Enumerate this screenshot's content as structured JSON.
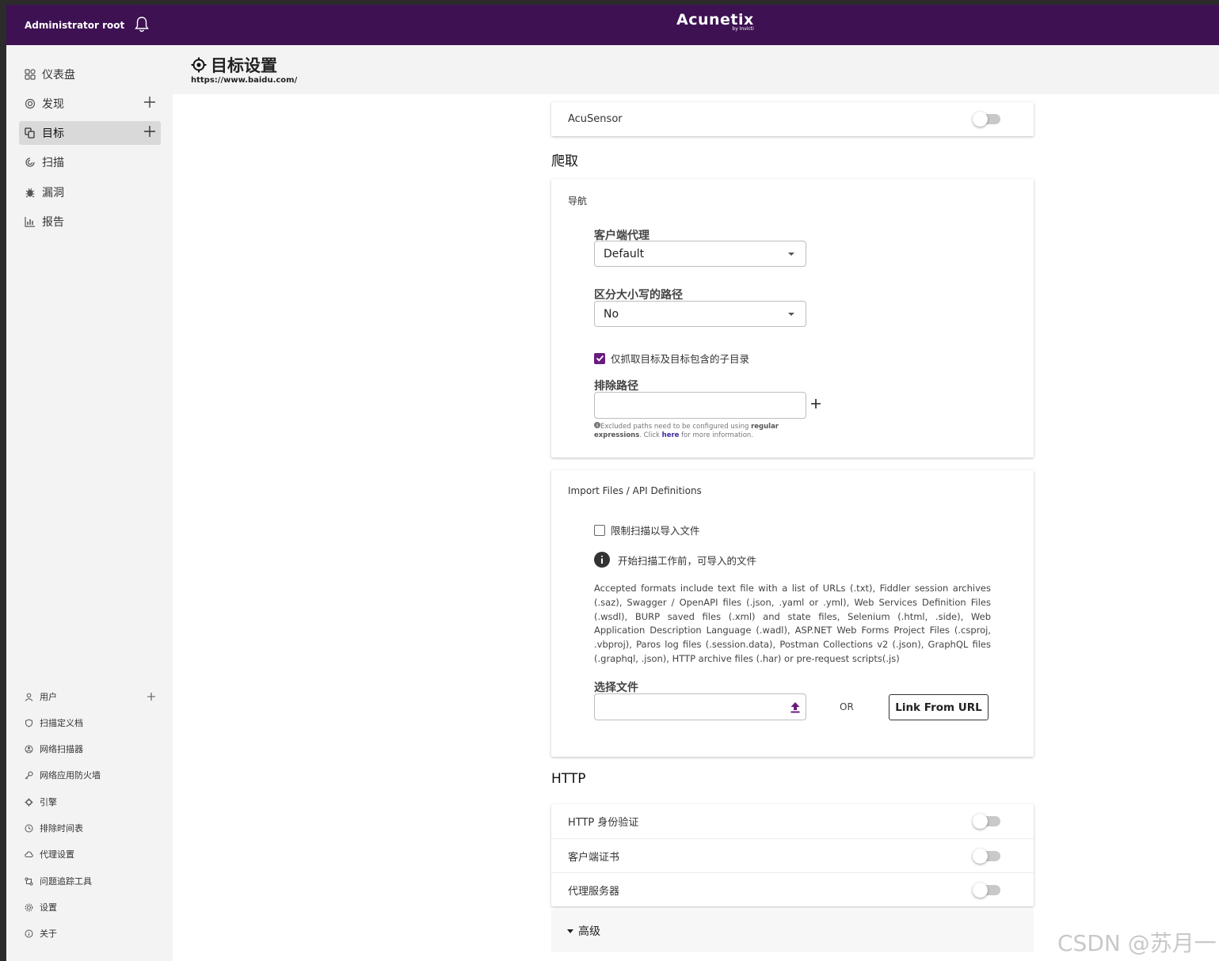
{
  "topbar": {
    "user": "Administrator root",
    "logo_name": "Acunetix",
    "logo_by": "by Invicti",
    "bell_icon": "bell-icon"
  },
  "sidebar": {
    "main_items": [
      {
        "label": "仪表盘",
        "icon": "dashboard-icon"
      },
      {
        "label": "发现",
        "icon": "discovery-icon",
        "has_add": true
      },
      {
        "label": "目标",
        "icon": "targets-icon",
        "has_add": true,
        "active": true
      },
      {
        "label": "扫描",
        "icon": "scans-icon"
      },
      {
        "label": "漏洞",
        "icon": "bug-icon"
      },
      {
        "label": "报告",
        "icon": "chart-icon"
      }
    ],
    "bottom_items": [
      {
        "label": "用户",
        "icon": "user-icon",
        "has_add": true
      },
      {
        "label": "扫描定义档",
        "icon": "shield-icon"
      },
      {
        "label": "网络扫描器",
        "icon": "network-icon"
      },
      {
        "label": "网络应用防火墙",
        "icon": "key-icon"
      },
      {
        "label": "引擎",
        "icon": "engine-icon"
      },
      {
        "label": "排除时间表",
        "icon": "clock-icon"
      },
      {
        "label": "代理设置",
        "icon": "cloud-icon"
      },
      {
        "label": "问题追踪工具",
        "icon": "tracker-icon"
      },
      {
        "label": "设置",
        "icon": "gear-icon"
      },
      {
        "label": "关于",
        "icon": "info-icon"
      }
    ]
  },
  "header": {
    "title": "目标设置",
    "url": "https://www.baidu.com/"
  },
  "acusensor": {
    "label": "AcuSensor",
    "enabled": false
  },
  "crawl": {
    "section_title": "爬取",
    "navigation": {
      "card_label": "导航",
      "user_agent_label": "客户端代理",
      "user_agent_value": "Default",
      "case_sensitive_label": "区分大小写的路径",
      "case_sensitive_value": "No",
      "limit_checkbox_label": "仅抓取目标及目标包含的子目录",
      "limit_checked": true,
      "exclude_label": "排除路径",
      "exclude_value": "",
      "hint_part1": "Excluded paths need to be configured using ",
      "hint_bold1": "regular expressions",
      "hint_part2": ". Click ",
      "hint_link": "here",
      "hint_part3": " for more information."
    },
    "import": {
      "card_label": "Import Files / API Definitions",
      "restrict_label": "限制扫描以导入文件",
      "restrict_checked": false,
      "info_text": "开始扫描工作前，可导入的文件",
      "formats_text": "Accepted formats include text file with a list of URLs (.txt), Fiddler session archives (.saz), Swagger / OpenAPI files (.json, .yaml or .yml), Web Services Definition Files (.wsdl), BURP saved files (.xml) and state files, Selenium (.html, .side), Web Application Description Language (.wadl), ASP.NET Web Forms Project Files (.csproj, .vbproj), Paros log files (.session.data), Postman Collections v2 (.json), GraphQL files (.graphql, .json), HTTP archive files (.har) or pre-request scripts(.js)",
      "choose_file_label": "选择文件",
      "or_text": "OR",
      "link_button": "Link From URL"
    }
  },
  "http": {
    "section_title": "HTTP",
    "rows": [
      {
        "label": "HTTP 身份验证",
        "enabled": false
      },
      {
        "label": "客户端证书",
        "enabled": false
      },
      {
        "label": "代理服务器",
        "enabled": false
      }
    ]
  },
  "advanced": {
    "label": "高级"
  },
  "watermark": "CSDN @苏月一",
  "colors": {
    "brand": "#3d1152",
    "checkbox": "#6a1b7e",
    "upload_icon": "#6a1b7e"
  }
}
